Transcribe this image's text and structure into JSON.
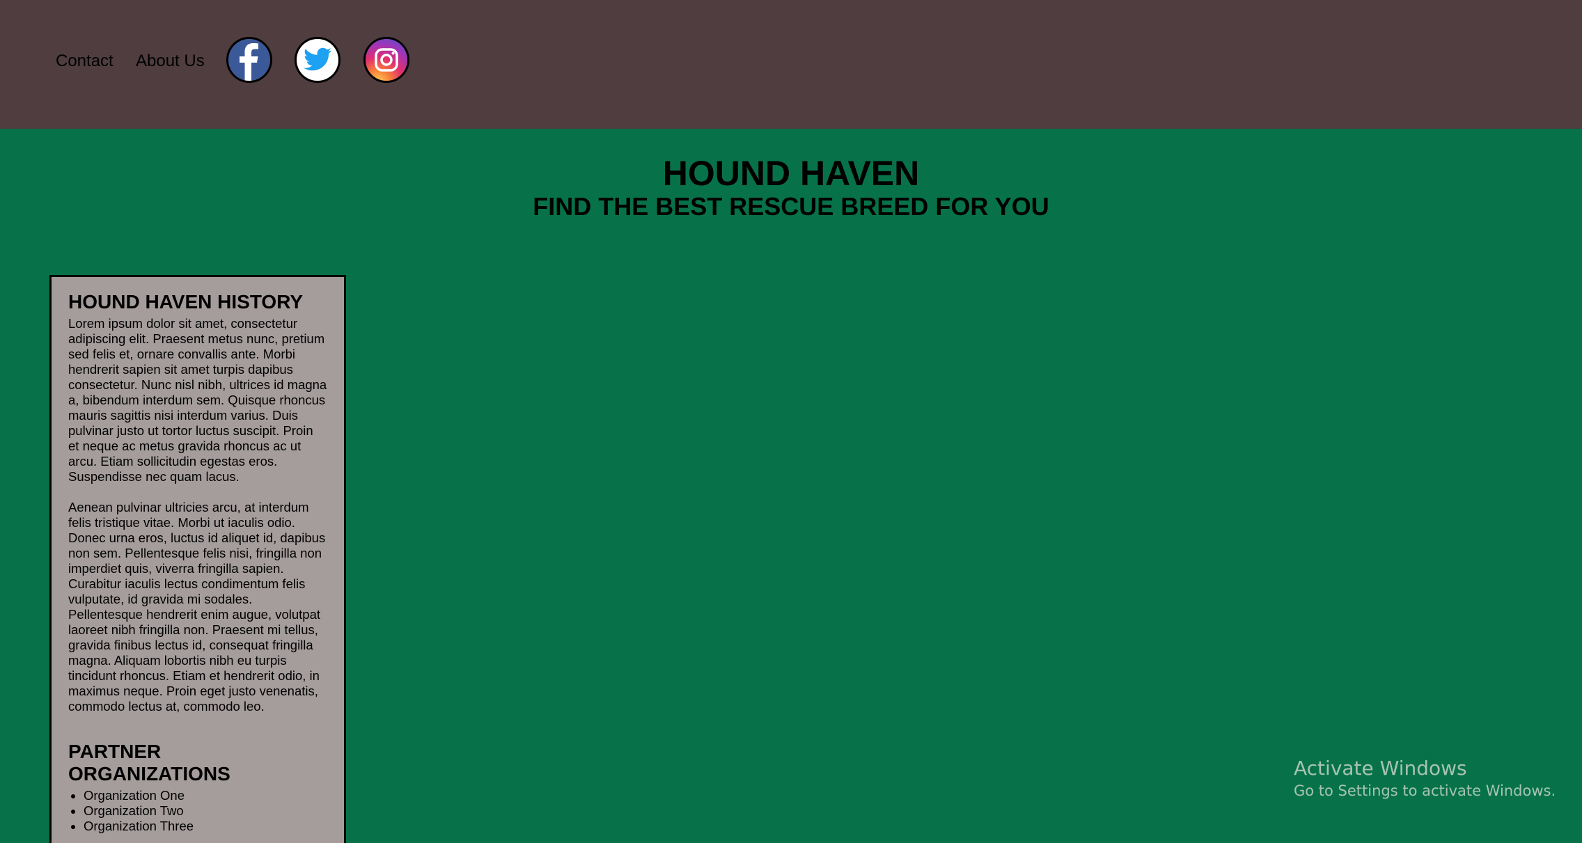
{
  "nav": {
    "contact": "Contact",
    "about": "About Us"
  },
  "social": [
    {
      "icon": "facebook-icon",
      "color": "#3b5998"
    },
    {
      "icon": "twitter-icon",
      "color": "#1da1f2"
    },
    {
      "icon": "instagram-icon",
      "color": "#c13584"
    }
  ],
  "hero": {
    "title": "HOUND HAVEN",
    "subtitle": "FIND THE BEST RESCUE BREED FOR YOU"
  },
  "sidebar": {
    "history_title": "HOUND HAVEN HISTORY",
    "paragraph1": "Lorem ipsum dolor sit amet, consectetur adipiscing elit. Praesent metus nunc, pretium sed felis et, ornare convallis ante. Morbi hendrerit sapien sit amet turpis dapibus consectetur. Nunc nisl nibh, ultrices id magna a, bibendum interdum sem. Quisque rhoncus mauris sagittis nisi interdum varius. Duis pulvinar justo ut tortor luctus suscipit. Proin et neque ac metus gravida rhoncus ac ut arcu. Etiam sollicitudin egestas eros. Suspendisse nec quam lacus.",
    "paragraph2": "Aenean pulvinar ultricies arcu, at interdum felis tristique vitae. Morbi ut iaculis odio. Donec urna eros, luctus id aliquet id, dapibus non sem. Pellentesque felis nisi, fringilla non imperdiet quis, viverra fringilla sapien. Curabitur iaculis lectus condimentum felis vulputate, id gravida mi sodales. Pellentesque hendrerit enim augue, volutpat laoreet nibh fringilla non. Praesent mi tellus, gravida finibus lectus id, consequat fringilla magna. Aliquam lobortis nibh eu turpis tincidunt rhoncus. Etiam et hendrerit odio, in maximus neque. Proin eget justo venenatis, commodo lectus at, commodo leo.",
    "partners_title": "PARTNER ORGANIZATIONS",
    "partners": [
      "Organization One",
      "Organization Two",
      "Organization Three"
    ]
  },
  "watermark": {
    "line1": "Activate Windows",
    "line2": "Go to Settings to activate Windows."
  },
  "colors": {
    "header_bg": "#4f3d40",
    "page_bg": "#077249",
    "sidebar_bg": "#a59c9c"
  }
}
